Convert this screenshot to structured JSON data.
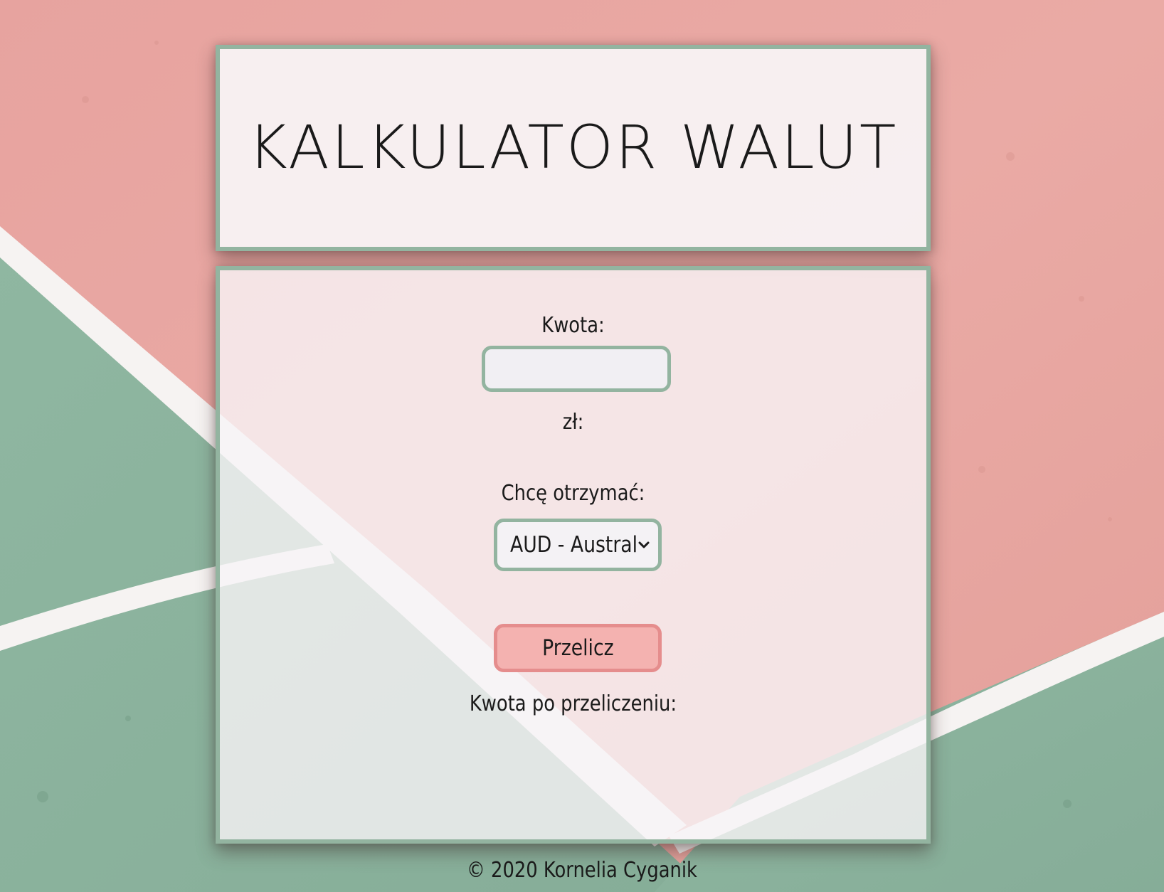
{
  "header": {
    "title": "KALKULATOR WALUT"
  },
  "form": {
    "amount_label": "Kwota:",
    "amount_value": "",
    "currency_suffix": "zł:",
    "target_label": "Chcę otrzymać:",
    "currency_select_value": "AUD - Austral",
    "convert_button_label": "Przelicz",
    "result_label": "Kwota po przeliczeniu:"
  },
  "footer": {
    "copyright": "© 2020 Kornelia Cyganik"
  },
  "colors": {
    "panel_border": "#93b4a0",
    "button_fill": "#f4b2b0",
    "button_border": "#e58d8d",
    "background_pink": "#e8a7a2",
    "background_green": "#8fb6a0"
  }
}
